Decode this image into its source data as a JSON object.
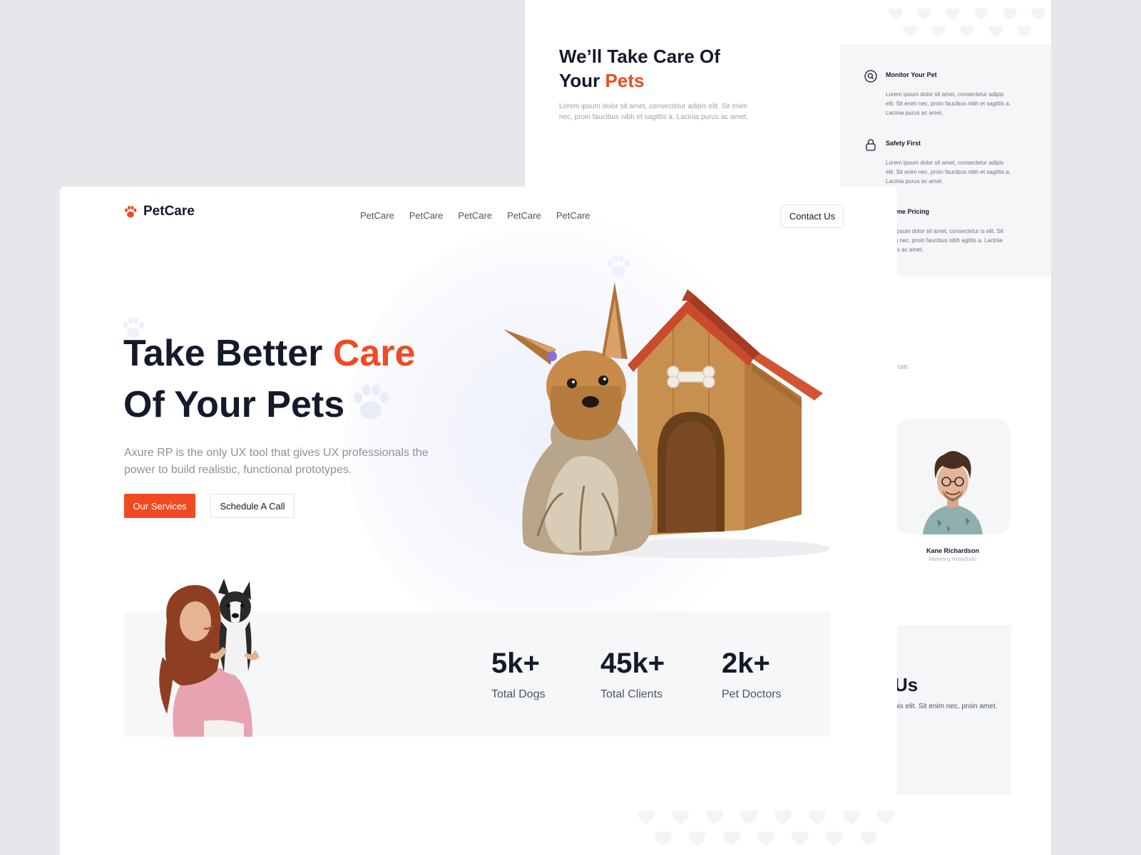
{
  "back_page": {
    "heading_line1": "We’ll Take Care Of",
    "heading_line2_prefix": "Your ",
    "heading_highlight": "Pets",
    "description": "Lorem ipsum dolor sit amet, consectetur adipis elit. Sit enim nec, proin faucibus nibh et sagittis a. Lacinia purus ac amet.",
    "features": [
      {
        "title": "Monitor Your Pet",
        "icon": "search-circle-icon",
        "desc": "Lorem ipsum dolor sit amet, consectetur adipis elit. Sit enim nec, proin faucibus nibh et sagittis a. Lacinia purus ac amet."
      },
      {
        "title": "Safety First",
        "icon": "lock-icon",
        "desc": "Lorem ipsum dolor sit amet, consectetur adipis elit. Sit enim nec, proin faucibus nibh et sagittis a. Lacinia purus ac amet."
      },
      {
        "title": "In One Pricing",
        "icon": "tag-icon",
        "desc": "em ipsum dolor sit amet, consectetur is elit. Sit enim nec, proin faucibus nibh agittis a. Lacinia purus ac amet."
      }
    ],
    "fragment_text": "roin",
    "team_member": {
      "name": "Kane Richardson",
      "role": "Marketing Head@abc"
    },
    "contact": {
      "title": "Us",
      "desc": "pis elit. Sit enim nec, proin amet."
    }
  },
  "header": {
    "brand": "PetCare",
    "nav": [
      "PetCare",
      "PetCare",
      "PetCare",
      "PetCare",
      "PetCare"
    ],
    "contact_button": "Contact Us"
  },
  "hero": {
    "title_part1": "Take Better ",
    "title_highlight": "Care",
    "title_line2": "Of Your Pets",
    "description": "Axure RP is the only UX tool that gives UX professionals the power to build realistic, functional prototypes.",
    "primary_button": "Our Services",
    "secondary_button": "Schedule A Call"
  },
  "stats": [
    {
      "value": "5k+",
      "label": "Total Dogs"
    },
    {
      "value": "45k+",
      "label": "Total Clients"
    },
    {
      "value": "2k+",
      "label": "Pet Doctors"
    }
  ],
  "colors": {
    "accent": "#f04a22",
    "text_dark": "#141a2b",
    "muted": "#8b919c"
  }
}
